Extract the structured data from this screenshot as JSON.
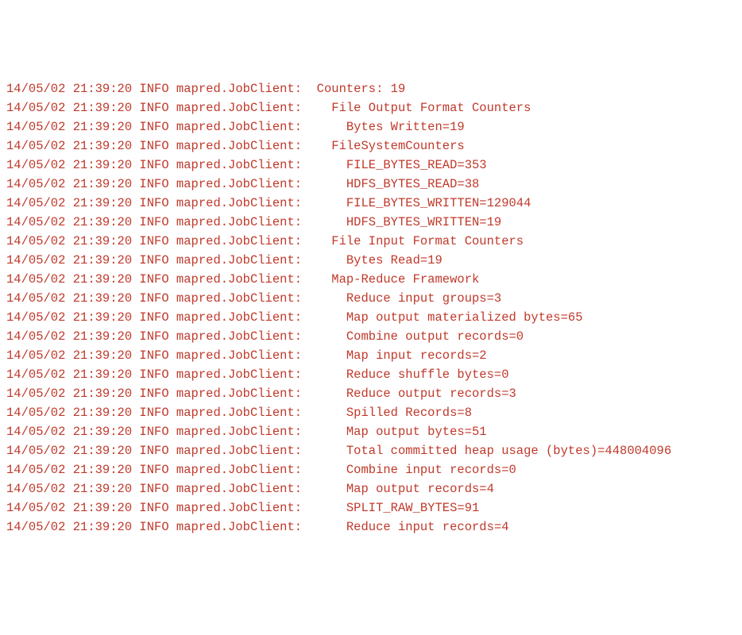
{
  "prefix": {
    "timestamp": "14/05/02 21:39:20",
    "level": "INFO",
    "source": "mapred.JobClient:"
  },
  "lines": [
    "  Counters: 19",
    "    File Output Format Counters",
    "      Bytes Written=19",
    "    FileSystemCounters",
    "      FILE_BYTES_READ=353",
    "      HDFS_BYTES_READ=38",
    "      FILE_BYTES_WRITTEN=129044",
    "      HDFS_BYTES_WRITTEN=19",
    "    File Input Format Counters",
    "      Bytes Read=19",
    "    Map-Reduce Framework",
    "      Reduce input groups=3",
    "      Map output materialized bytes=65",
    "      Combine output records=0",
    "      Map input records=2",
    "      Reduce shuffle bytes=0",
    "      Reduce output records=3",
    "      Spilled Records=8",
    "      Map output bytes=51",
    "      Total committed heap usage (bytes)=448004096",
    "      Combine input records=0",
    "      Map output records=4",
    "      SPLIT_RAW_BYTES=91",
    "      Reduce input records=4"
  ]
}
